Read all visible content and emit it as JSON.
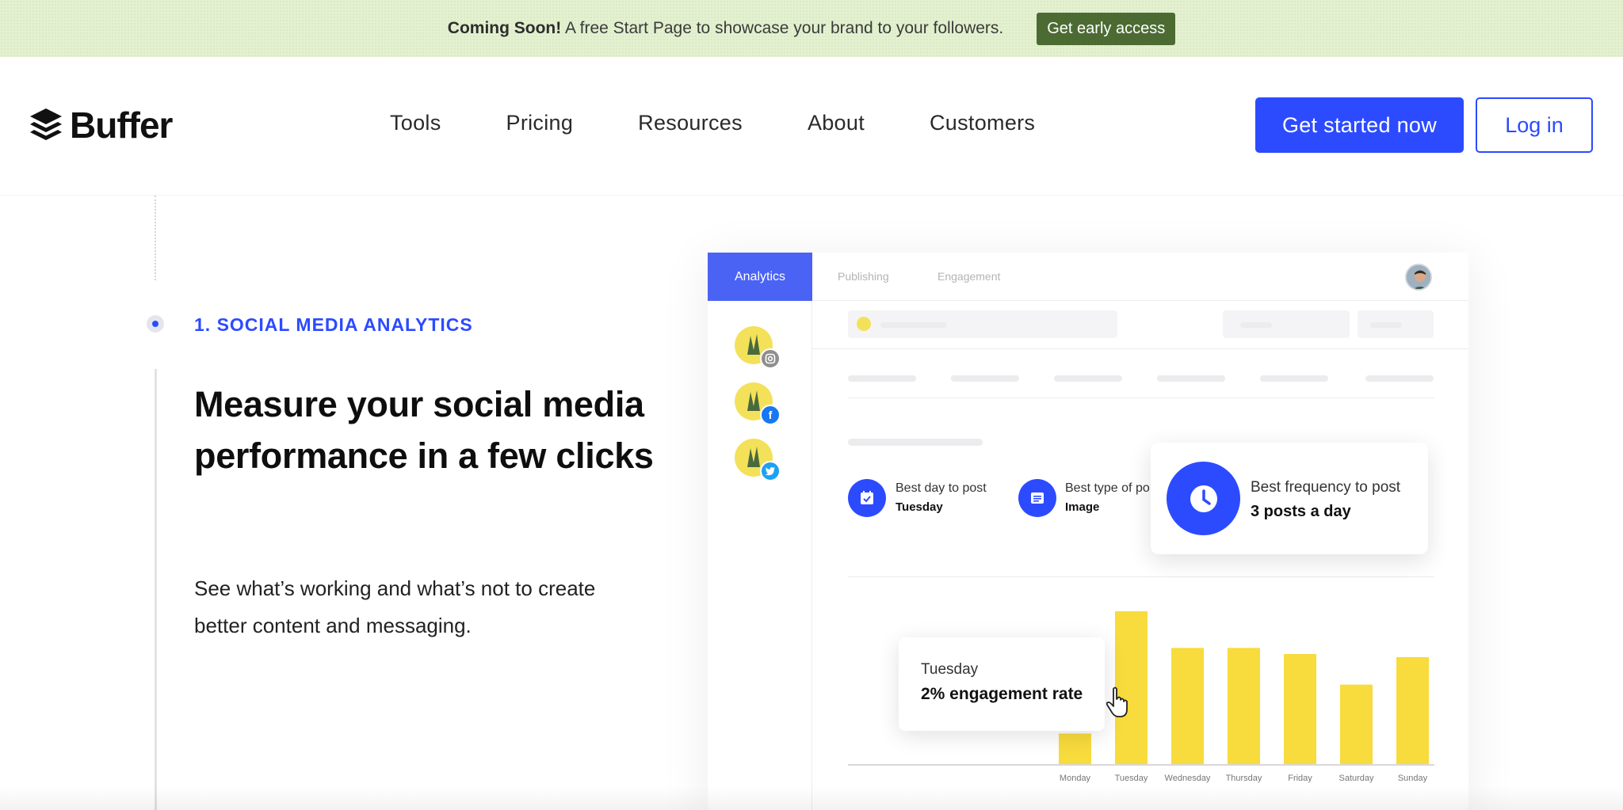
{
  "announcement": {
    "bold": "Coming Soon!",
    "text": "A free Start Page to showcase your brand to your followers.",
    "button": "Get early access"
  },
  "header": {
    "brand": "Buffer",
    "nav": [
      "Tools",
      "Pricing",
      "Resources",
      "About",
      "Customers"
    ],
    "cta_primary": "Get started now",
    "cta_secondary": "Log in"
  },
  "feature": {
    "step_label": "1. SOCIAL MEDIA ANALYTICS",
    "headline": "Measure your social media performance in a few clicks",
    "subtext": "See what’s working and what’s not to create better content and messaging."
  },
  "dashboard": {
    "tabs": [
      "Analytics",
      "Publishing",
      "Engagement"
    ],
    "accounts": [
      {
        "network": "instagram",
        "icon": "instagram-icon"
      },
      {
        "network": "facebook",
        "icon": "facebook-icon"
      },
      {
        "network": "twitter",
        "icon": "twitter-icon"
      }
    ],
    "stats": [
      {
        "label": "Best day to post",
        "value": "Tuesday"
      },
      {
        "label": "Best type of po",
        "value": "Image"
      }
    ],
    "frequency": {
      "label": "Best frequency to post",
      "value": "3 posts a day"
    },
    "tooltip": {
      "day": "Tuesday",
      "rate": "2% engagement rate"
    },
    "colors": {
      "accent": "#2c4bff",
      "bar": "#f8db3c",
      "announce_bg": "#e4f1d0",
      "announce_btn": "#4c6b33"
    }
  },
  "chart_data": {
    "type": "bar",
    "categories": [
      "Monday",
      "Tuesday",
      "Wednesday",
      "Thursday",
      "Friday",
      "Saturday",
      "Sunday"
    ],
    "values": [
      0.2,
      1.0,
      0.76,
      0.76,
      0.72,
      0.52,
      0.7
    ],
    "ylim": [
      0,
      1
    ],
    "grid": false,
    "ylabel": "",
    "xlabel": ""
  }
}
